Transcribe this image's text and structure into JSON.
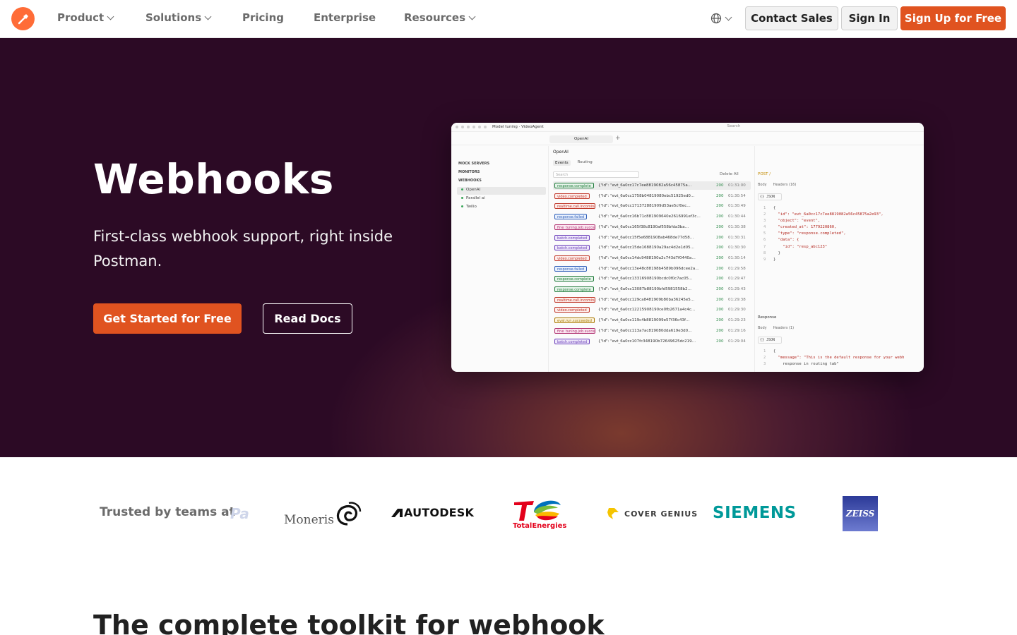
{
  "nav": {
    "items": [
      "Product",
      "Solutions",
      "Pricing",
      "Enterprise",
      "Resources"
    ],
    "contact_label": "Contact Sales",
    "signin_label": "Sign In",
    "signup_label": "Sign Up for Free"
  },
  "hero": {
    "title": "Webhooks",
    "subtitle": "First-class webhook support, right inside Postman.",
    "primary_cta": "Get Started for Free",
    "secondary_cta": "Read Docs"
  },
  "app": {
    "breadcrumb": "Model tuning · VideoAgent",
    "search_placeholder": "Search",
    "open_tab": "OpenAI",
    "sidebar": {
      "sections": [
        "MOCK SERVERS",
        "MONITORS",
        "WEBHOOKS"
      ],
      "webhooks": [
        "OpenAI",
        "Parallel ai",
        "Twilio"
      ]
    },
    "panel_title": "OpenAI",
    "panel_tabs": [
      "Events",
      "Routing"
    ],
    "filter_placeholder": "Search",
    "delete_all": "Delete All",
    "events": [
      {
        "type": "response.complete",
        "body": "{\"id\": \"evt_6a0cc17c7ee8819082a56c45875a…",
        "status": "200",
        "time": "01:31:00"
      },
      {
        "type": "video.completed",
        "body": "{\"id\": \"evt_6a0cc1758b04819080ebc51925ed0…",
        "status": "200",
        "time": "01:30:54"
      },
      {
        "type": "realtime.call.incoming",
        "body": "{\"id\": \"evt_6a0cc171372881909d53ae5cf0ec…",
        "status": "200",
        "time": "01:30:49"
      },
      {
        "type": "response.failed",
        "body": "{\"id\": \"evt_6a0cc16b71c881909640e2616991ef3c…",
        "status": "200",
        "time": "01:30:44"
      },
      {
        "type": "fine_tuning.job.succeeded",
        "body": "{\"id\": \"evt_6a0cc165f38c8190af558bfda3ba…",
        "status": "200",
        "time": "01:30:38"
      },
      {
        "type": "batch.completed",
        "body": "{\"id\": \"evt_6a0cc15f5e6881908ab468de77d58…",
        "status": "200",
        "time": "01:30:31"
      },
      {
        "type": "batch.completed",
        "body": "{\"id\": \"evt_6a0cc15de1688190a29ac4d2e1d05…",
        "status": "200",
        "time": "01:30:30"
      },
      {
        "type": "video.completed",
        "body": "{\"id\": \"evt_6a0cc14dc9488190a2c743d7f0440a…",
        "status": "200",
        "time": "01:30:14"
      },
      {
        "type": "response.failed",
        "body": "{\"id\": \"evt_6a0cc13e48c88198b4589b096dcee2a…",
        "status": "200",
        "time": "01:29:58"
      },
      {
        "type": "response.complete",
        "body": "{\"id\": \"evt_6a0cc13316908190bcdc0f0c7ac05…",
        "status": "200",
        "time": "01:29:47"
      },
      {
        "type": "response.complete",
        "body": "{\"id\": \"evt_6a0cc13087b88190bfd5981558b2…",
        "status": "200",
        "time": "01:29:43"
      },
      {
        "type": "realtime.call.incoming",
        "body": "{\"id\": \"evt_6a0cc129ca8481909b80ba36245e5…",
        "status": "200",
        "time": "01:29:38"
      },
      {
        "type": "video.completed",
        "body": "{\"id\": \"evt_6a0cc12215908190ce0fb2671a4c4c…",
        "status": "200",
        "time": "01:29:30"
      },
      {
        "type": "eval.run.succeeded",
        "body": "{\"id\": \"evt_6a0cc119c4b8819099e57f36c43f…",
        "status": "200",
        "time": "01:29:23"
      },
      {
        "type": "fine_tuning.job.succeeded",
        "body": "{\"id\": \"evt_6a0cc113a7ac819080dda619e3d0…",
        "status": "200",
        "time": "01:29:16"
      },
      {
        "type": "batch.completed",
        "body": "{\"id\": \"evt_6a0cc107fc348190b72649625dc219…",
        "status": "200",
        "time": "01:29:04"
      }
    ],
    "request": {
      "method": "POST /",
      "tabs": [
        "Body",
        "Headers (16)"
      ],
      "format": "{} JSON",
      "lines": [
        "{",
        "  \"id\": \"evt_6a0cc17c7ee8819082a56c45875a2e93\",",
        "  \"object\": \"event\",",
        "  \"created_at\": 1779220860,",
        "  \"type\": \"response.completed\",",
        "  \"data\": {",
        "    \"id\": \"resp_abc123\"",
        "  }",
        "}"
      ]
    },
    "response": {
      "title": "Response",
      "tabs": [
        "Body",
        "Headers (1)"
      ],
      "format": "{} JSON",
      "lines": [
        "{",
        "  \"message\": \"This is the default response for your webh",
        "    response in routing tab\""
      ]
    }
  },
  "trusted": {
    "label": "Trusted by teams at",
    "logos": [
      "Moneris",
      "AUTODESK",
      "TotalEnergies",
      "COVER GENIUS",
      "SIEMENS",
      "ZEISS"
    ]
  },
  "section": {
    "title": "The complete toolkit for webhook"
  },
  "colors": {
    "brand": "#ff6c37",
    "cta": "#e05320",
    "hero_bg": "#2a0a24"
  }
}
